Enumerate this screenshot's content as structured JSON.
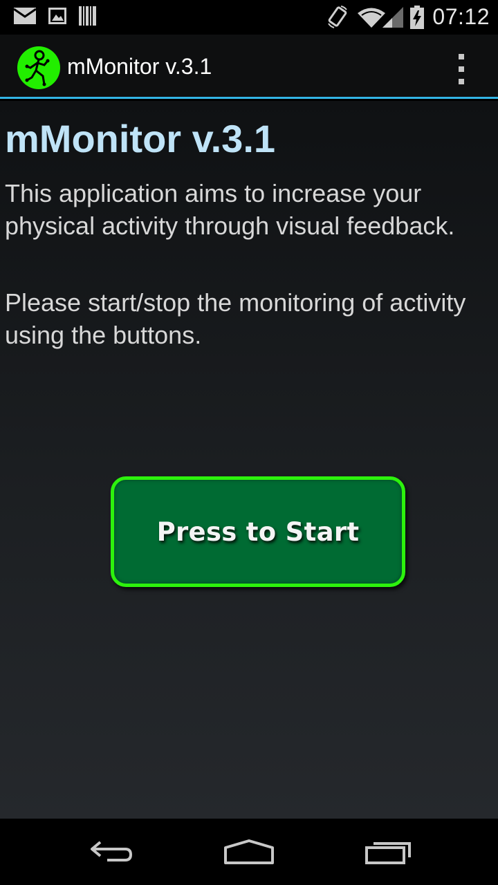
{
  "status_bar": {
    "time": "07:12",
    "icons": [
      "email-icon",
      "gallery-icon",
      "barcode-icon",
      "rotation-icon",
      "wifi-icon",
      "signal-icon",
      "battery-charging-icon"
    ]
  },
  "action_bar": {
    "title": "mMonitor v.3.1",
    "app_icon": "running-man-icon",
    "menu_icon": "overflow-menu-icon"
  },
  "main": {
    "heading": "mMonitor v.3.1",
    "paragraph1": "This application aims to increase your physical activity through visual feedback.",
    "paragraph2": "Please start/stop the monitoring of activity using the buttons.",
    "start_button_label": "Press to Start"
  },
  "nav_bar": {
    "icons": [
      "back-icon",
      "home-icon",
      "recent-apps-icon"
    ]
  },
  "colors": {
    "accent": "#33b5e5",
    "heading": "#bfe3f7",
    "button_fill": "#006b33",
    "button_border": "#2df20d"
  }
}
